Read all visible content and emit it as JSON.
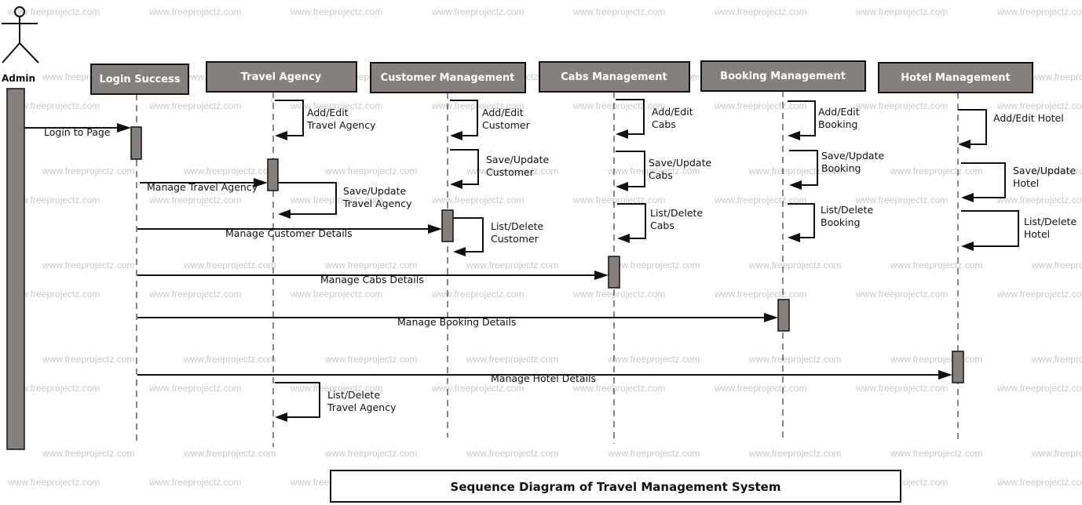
{
  "watermark": "www.freeprojectz.com",
  "actor": {
    "label": "Admin"
  },
  "lifelines": [
    {
      "id": "login",
      "label": "Login Success"
    },
    {
      "id": "travel",
      "label": "Travel Agency"
    },
    {
      "id": "customer",
      "label": "Customer Management"
    },
    {
      "id": "cabs",
      "label": "Cabs Management"
    },
    {
      "id": "booking",
      "label": "Booking Management"
    },
    {
      "id": "hotel",
      "label": "Hotel Management"
    }
  ],
  "messages": {
    "login_to_page": "Login to Page",
    "manage_travel": "Manage Travel Agency",
    "manage_customer": "Manage Customer Details",
    "manage_cabs": "Manage Cabs Details",
    "manage_booking": "Manage Booking Details",
    "manage_hotel": "Manage Hotel Details"
  },
  "self_messages": {
    "travel": [
      [
        "Add/Edit",
        "Travel Agency"
      ],
      [
        "Save/Update",
        "Travel Agency"
      ],
      [
        "List/Delete",
        "Travel Agency"
      ]
    ],
    "customer": [
      [
        "Add/Edit",
        "Customer"
      ],
      [
        "Save/Update",
        "Customer"
      ],
      [
        "List/Delete",
        "Customer"
      ]
    ],
    "cabs": [
      [
        "Add/Edit",
        "Cabs"
      ],
      [
        "Save/Update",
        "Cabs"
      ],
      [
        "List/Delete",
        "Cabs"
      ]
    ],
    "booking": [
      [
        "Add/Edit",
        "Booking"
      ],
      [
        "Save/Update",
        "Booking"
      ],
      [
        "List/Delete",
        "Booking"
      ]
    ],
    "hotel": [
      [
        "Add/Edit Hotel"
      ],
      [
        "Save/Update",
        "Hotel"
      ],
      [
        "List/Delete",
        "Hotel"
      ]
    ]
  },
  "title": "Sequence Diagram of Travel Management System"
}
